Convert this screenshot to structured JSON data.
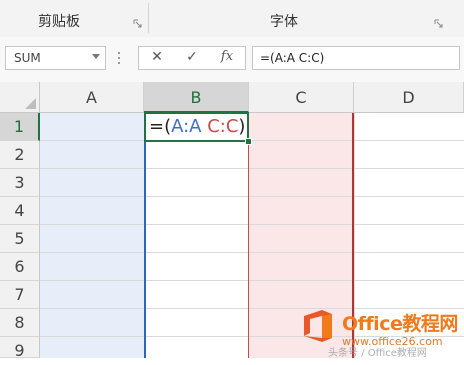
{
  "ribbon": {
    "groups": [
      {
        "label": "剪贴板"
      },
      {
        "label": "字体"
      }
    ]
  },
  "formula_bar": {
    "name_box": "SUM",
    "cancel_glyph": "✕",
    "enter_glyph": "✓",
    "fx_label": "fx",
    "formula": "=(A:A C:C)"
  },
  "grid": {
    "columns": [
      "A",
      "B",
      "C",
      "D"
    ],
    "rows": [
      "1",
      "2",
      "3",
      "4",
      "5",
      "6",
      "7",
      "8",
      "9"
    ],
    "active_cell": "B1",
    "edit_text": {
      "prefix": "=(",
      "ref_a": "A:A",
      "space": " ",
      "ref_c": "C:C",
      "suffix": ")"
    }
  },
  "colors": {
    "accent_green": "#217346",
    "ref_a_blue": "#3e70c9",
    "ref_c_red": "#c94a4a"
  },
  "watermark": {
    "brand": "Office教程网",
    "url": "www.office26.com",
    "credit": "头条号 / Office教程网"
  }
}
